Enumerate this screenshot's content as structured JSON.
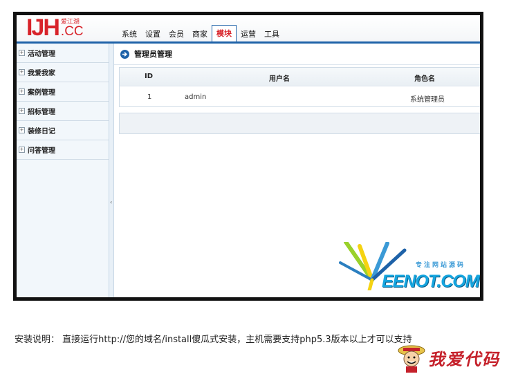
{
  "header": {
    "logo_main": "IJH",
    "logo_cn": "爱江湖",
    "logo_cc": ".CC",
    "nav": [
      {
        "label": "系统",
        "active": false
      },
      {
        "label": "设置",
        "active": false
      },
      {
        "label": "会员",
        "active": false
      },
      {
        "label": "商家",
        "active": false
      },
      {
        "label": "模块",
        "active": true
      },
      {
        "label": "运营",
        "active": false
      },
      {
        "label": "工具",
        "active": false
      }
    ]
  },
  "sidebar": {
    "items": [
      {
        "label": "活动管理"
      },
      {
        "label": "我爱我家"
      },
      {
        "label": "案例管理"
      },
      {
        "label": "招标管理"
      },
      {
        "label": "装修日记"
      },
      {
        "label": "问答管理"
      }
    ]
  },
  "main": {
    "title": "管理员管理",
    "table": {
      "columns": [
        "ID",
        "用户名",
        "角色名"
      ],
      "rows": [
        {
          "id": "1",
          "username": "admin",
          "role": "系统管理员"
        }
      ]
    }
  },
  "watermark": {
    "sub": "专注网站源码",
    "main": "EENOT.COM"
  },
  "install_note": "安装说明： 直接运行http://您的域名/install傻瓜式安装，主机需要支持php5.3版本以上才可以支持",
  "brand": "我爱代码",
  "colors": {
    "accent": "#1e62a8",
    "logo_red": "#d8232a",
    "sidebar_bg": "#f2f7fb"
  }
}
